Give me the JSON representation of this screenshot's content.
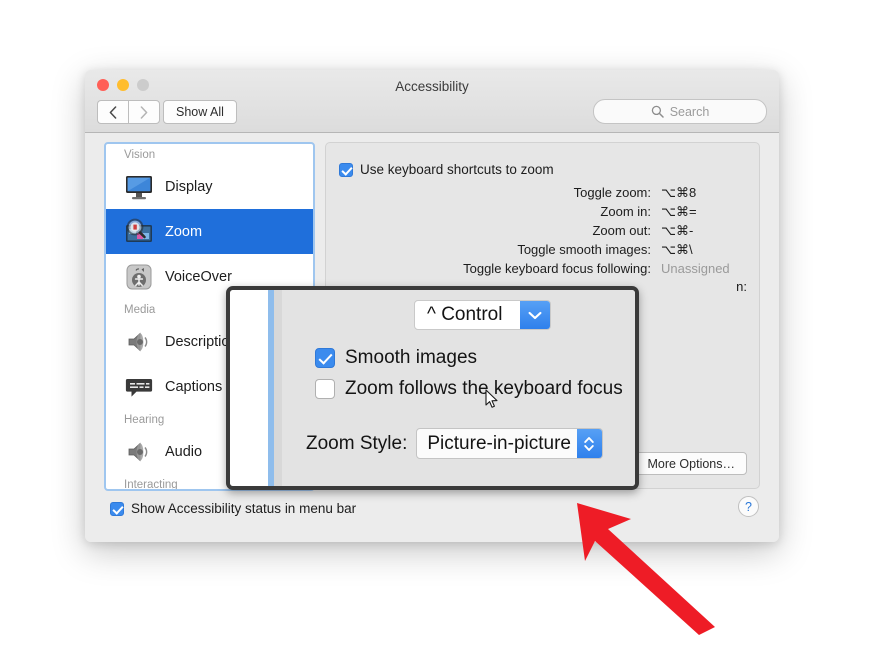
{
  "window": {
    "title": "Accessibility",
    "traffic_lights": [
      "close-button",
      "minimize-button",
      "zoom-button"
    ],
    "nav": {
      "back_label": "‹",
      "forward_label": "›",
      "show_all_label": "Show All"
    },
    "search": {
      "placeholder": "Search",
      "icon": "search-icon"
    }
  },
  "sidebar": {
    "groups": [
      {
        "label": "Vision",
        "items": [
          {
            "label": "Display",
            "icon": "display-monitor-icon",
            "selected": false
          },
          {
            "label": "Zoom",
            "icon": "zoom-magnifier-icon",
            "selected": true
          },
          {
            "label": "VoiceOver",
            "icon": "voiceover-icon",
            "selected": false
          }
        ]
      },
      {
        "label": "Media",
        "items": [
          {
            "label": "Descriptions",
            "icon": "speaker-icon",
            "selected": false
          },
          {
            "label": "Captions",
            "icon": "captions-icon",
            "selected": false
          }
        ]
      },
      {
        "label": "Hearing",
        "items": [
          {
            "label": "Audio",
            "icon": "speaker-icon",
            "selected": false
          }
        ]
      },
      {
        "label": "Interacting",
        "items": []
      }
    ]
  },
  "pane": {
    "keyboard_shortcuts_checkbox": {
      "label": "Use keyboard shortcuts to zoom",
      "checked": true
    },
    "shortcuts": [
      {
        "label": "Toggle zoom:",
        "key": "⌥⌘8",
        "unassigned": false
      },
      {
        "label": "Zoom in:",
        "key": "⌥⌘=",
        "unassigned": false
      },
      {
        "label": "Zoom out:",
        "key": "⌥⌘-",
        "unassigned": false
      },
      {
        "label": "Toggle smooth images:",
        "key": "⌥⌘\\",
        "unassigned": false
      },
      {
        "label": "Toggle keyboard focus following:",
        "key": "Unassigned",
        "unassigned": true
      }
    ],
    "modifier_label_visible_fragment": "n:",
    "more_options_label": "More Options…"
  },
  "bottom": {
    "menubar_status": {
      "label": "Show Accessibility status in menu bar",
      "checked": true
    },
    "help_label": "?"
  },
  "zoom_overlay": {
    "modifier_dropdown": {
      "value": "^ Control",
      "icon": "chevron-down-icon"
    },
    "smooth_images": {
      "label": "Smooth images",
      "checked": true
    },
    "keyboard_focus": {
      "label": "Zoom follows the keyboard focus",
      "checked": false
    },
    "zoom_style": {
      "label": "Zoom Style:",
      "value": "Picture-in-picture",
      "icon": "up-down-chevron-icon"
    },
    "cursor": "mouse-pointer-icon"
  },
  "annotation": {
    "arrow": "red-arrow-icon",
    "color": "#ee1c26"
  },
  "colors": {
    "selection_blue": "#1f6fdb",
    "checkbox_blue": "#3b8bee",
    "annotation_red": "#ee1c26",
    "window_chrome": "#ececec",
    "pane_background": "#e6e6e6",
    "sidebar_focus_ring": "#9fc6ef"
  }
}
